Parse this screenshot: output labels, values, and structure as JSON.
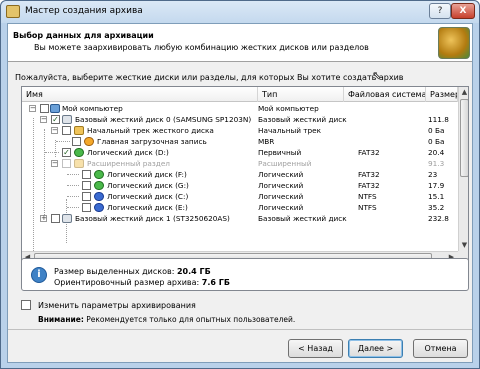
{
  "window": {
    "title": "Мастер создания архива",
    "help": "?",
    "close": "X"
  },
  "header": {
    "title": "Выбор данных для архивации",
    "subtitle": "Вы можете заархивировать любую комбинацию жестких дисков или разделов"
  },
  "instruction": "Пожалуйста, выберите жесткие диски или разделы, для которых Вы хотите создать архив",
  "table": {
    "columns": [
      "Имя",
      "Тип",
      "Файловая система",
      "Размер"
    ],
    "rows": [
      {
        "name": "Мой компьютер",
        "type": "Мой компьютер",
        "fs": "",
        "size": "",
        "icon": "computer-icon",
        "checked": false,
        "expanded": true
      },
      {
        "name": "Базовый жесткий диск 0 (SAMSUNG SP1203N)",
        "type": "Базовый жесткий диск",
        "fs": "",
        "size": "111.8",
        "icon": "hard-disk-icon",
        "checked": true,
        "expanded": true
      },
      {
        "name": "Начальный трек жесткого диска",
        "type": "Начальный трек",
        "fs": "",
        "size": "0 Ба",
        "icon": "folder-icon",
        "checked": false,
        "expanded": true
      },
      {
        "name": "Главная загрузочная запись",
        "type": "MBR",
        "fs": "",
        "size": "0 Ба",
        "icon": "mbr-icon",
        "checked": false
      },
      {
        "name": "Логический диск (D:)",
        "type": "Первичный",
        "fs": "FAT32",
        "size": "20.4",
        "icon": "green-partition-icon",
        "checked": true
      },
      {
        "name": "Расширенный раздел",
        "type": "Расширенный",
        "fs": "",
        "size": "91.3",
        "icon": "folder-icon",
        "checked": false,
        "disabled": true,
        "expanded": true
      },
      {
        "name": "Логический диск (F:)",
        "type": "Логический",
        "fs": "FAT32",
        "size": "23",
        "icon": "green-partition-icon",
        "checked": false
      },
      {
        "name": "Логический диск (G:)",
        "type": "Логический",
        "fs": "FAT32",
        "size": "17.9",
        "icon": "green-partition-icon",
        "checked": false
      },
      {
        "name": "Логический диск (C:)",
        "type": "Логический",
        "fs": "NTFS",
        "size": "15.1",
        "icon": "blue-partition-icon",
        "checked": false
      },
      {
        "name": "Логический диск (E:)",
        "type": "Логический",
        "fs": "NTFS",
        "size": "35.2",
        "icon": "blue-partition-icon",
        "checked": false
      },
      {
        "name": "Базовый жесткий диск 1 (ST3250620AS)",
        "type": "Базовый жесткий диск",
        "fs": "",
        "size": "232.8",
        "icon": "hard-disk-icon",
        "checked": false,
        "expanded": false
      }
    ]
  },
  "info": {
    "selected_label": "Размер выделенных дисков:",
    "selected_value": "20.4 ГБ",
    "archive_label": "Ориентировочный размер архива:",
    "archive_value": "7.6 ГБ"
  },
  "options": {
    "label": "Изменить параметры архивирования",
    "warning_bold": "Внимание:",
    "warning_text": "Рекомендуется только для опытных пользователей."
  },
  "buttons": {
    "back": "< Назад",
    "next": "Далее >",
    "cancel": "Отмена"
  }
}
